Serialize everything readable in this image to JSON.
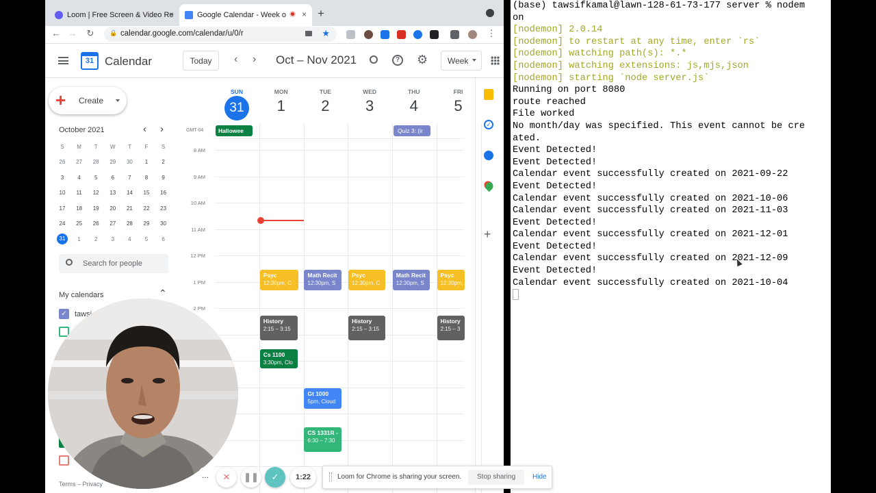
{
  "browser": {
    "tabs": [
      {
        "title": "Loom | Free Screen & Video Re",
        "close": "×"
      },
      {
        "title": "Google Calendar - Week o",
        "close": "×"
      }
    ],
    "new_tab": "+",
    "url": "calendar.google.com/calendar/u/0/r"
  },
  "calendar": {
    "app_name": "Calendar",
    "logo_num": "31",
    "today_button": "Today",
    "range_title": "Oct – Nov 2021",
    "view_select": "Week",
    "create_label": "Create",
    "mini": {
      "title": "October 2021",
      "dows": [
        "S",
        "M",
        "T",
        "W",
        "T",
        "F",
        "S"
      ],
      "weeks": [
        [
          "26",
          "27",
          "28",
          "29",
          "30",
          "1",
          "2"
        ],
        [
          "3",
          "4",
          "5",
          "6",
          "7",
          "8",
          "9"
        ],
        [
          "10",
          "11",
          "12",
          "13",
          "14",
          "15",
          "16"
        ],
        [
          "17",
          "18",
          "19",
          "20",
          "21",
          "22",
          "23"
        ],
        [
          "24",
          "25",
          "26",
          "27",
          "28",
          "29",
          "30"
        ],
        [
          "31",
          "1",
          "2",
          "3",
          "4",
          "5",
          "6"
        ]
      ]
    },
    "search_people": "Search for people",
    "my_calendars": "My calendars",
    "cal_item_1": "tawsi",
    "footer_terms": "Terms – Privacy",
    "timezone": "GMT-04",
    "days": [
      {
        "dow": "SUN",
        "num": "31"
      },
      {
        "dow": "MON",
        "num": "1"
      },
      {
        "dow": "TUE",
        "num": "2"
      },
      {
        "dow": "WED",
        "num": "3"
      },
      {
        "dow": "THU",
        "num": "4"
      },
      {
        "dow": "FRI",
        "num": "5"
      }
    ],
    "hours": [
      "8 AM",
      "9 AM",
      "10 AM",
      "11 AM",
      "12 PM",
      "1 PM",
      "2 PM"
    ],
    "allday": [
      {
        "title": "Hallowee",
        "color": "#33b679"
      },
      {
        "title": "Quiz 3: (ir",
        "color": "#7986cb"
      }
    ],
    "events": {
      "psyc": {
        "title": "Psyc",
        "sub": "12:30pm, C",
        "color": "#f6bf26"
      },
      "math_tue": {
        "title": "Math Recit",
        "sub": "12:30pm, S",
        "color": "#7986cb"
      },
      "psyc_wed": {
        "title": "Psyc",
        "sub": "12:30pm, C",
        "color": "#f6bf26"
      },
      "math_thu": {
        "title": "Math Recit",
        "sub": "12:30pm, S",
        "color": "#7986cb"
      },
      "psyc_fri": {
        "title": "Psyc",
        "sub": "12:30pm, C",
        "color": "#f6bf26"
      },
      "hist_mon": {
        "title": "History",
        "sub": "2:15 – 3:15",
        "color": "#616161"
      },
      "hist_wed": {
        "title": "History",
        "sub": "2:15 – 3:15",
        "color": "#616161"
      },
      "hist_fri": {
        "title": "History",
        "sub": "2:15 – 3",
        "color": "#616161"
      },
      "cs1100": {
        "title": "Cs 1100",
        "sub": "3:30pm, Clo",
        "color": "#0b8043"
      },
      "gt1000": {
        "title": "Gt 1000",
        "sub": "5pm, Cloud",
        "color": "#4285f4"
      },
      "cs1331": {
        "title": "CS 1331R -",
        "sub": "6:30 – 7:30",
        "color": "#33b679"
      }
    }
  },
  "terminal": {
    "lines": [
      {
        "text": "(base) tawsifkamal@lawn-128-61-73-177 server % nodem",
        "style": "k"
      },
      {
        "text": "on",
        "style": "k"
      },
      {
        "text": "[nodemon] 2.0.14",
        "style": "g"
      },
      {
        "text": "[nodemon] to restart at any time, enter `rs`",
        "style": "g"
      },
      {
        "text": "[nodemon] watching path(s): *.*",
        "style": "g"
      },
      {
        "text": "[nodemon] watching extensions: js,mjs,json",
        "style": "g"
      },
      {
        "text": "[nodemon] starting `node server.js`",
        "style": "g"
      },
      {
        "text": "Running on port 8080",
        "style": "k"
      },
      {
        "text": "route reached",
        "style": "k"
      },
      {
        "text": "File worked",
        "style": "k"
      },
      {
        "text": "No month/day was specified. This event cannot be cre",
        "style": "k"
      },
      {
        "text": "ated.",
        "style": "k"
      },
      {
        "text": "Event Detected!",
        "style": "k"
      },
      {
        "text": "Event Detected!",
        "style": "k"
      },
      {
        "text": "Calendar event successfully created on 2021-09-22",
        "style": "k"
      },
      {
        "text": "Event Detected!",
        "style": "k"
      },
      {
        "text": "Calendar event successfully created on 2021-10-06",
        "style": "k"
      },
      {
        "text": "Calendar event successfully created on 2021-11-03",
        "style": "k"
      },
      {
        "text": "Event Detected!",
        "style": "k"
      },
      {
        "text": "Calendar event successfully created on 2021-12-01",
        "style": "k"
      },
      {
        "text": "Event Detected!",
        "style": "k"
      },
      {
        "text": "Calendar event successfully created on 2021-12-09",
        "style": "k"
      },
      {
        "text": "Event Detected!",
        "style": "k"
      },
      {
        "text": "Calendar event successfully created on 2021-10-04",
        "style": "k"
      }
    ]
  },
  "loom": {
    "timer": "1:22",
    "more": "...",
    "share_text": "Loom for Chrome is sharing your screen.",
    "stop_sharing": "Stop sharing",
    "hide": "Hide"
  }
}
